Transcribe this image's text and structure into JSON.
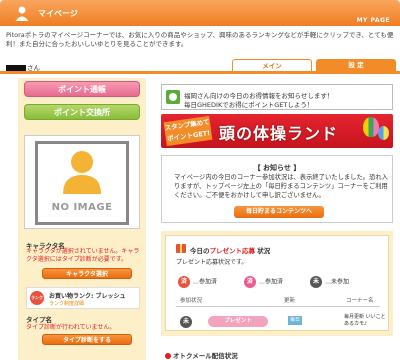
{
  "header": {
    "title": "マイページ",
    "right_label": "MY PAGE"
  },
  "intro": "Pitoraポトラのマイページコーナーでは、お気に入りの商品やショップ、興味のあるランキングなどが手軽にクリップでき、とても便利！また自分に合ったおいしいゆとりを見ることができます。",
  "user": {
    "suffix": "さん"
  },
  "tabs": {
    "main": "メイン",
    "settings": "設 定"
  },
  "left": {
    "btn_history": "ポイント通帳",
    "btn_exchange": "ポイント交換所",
    "no_image": "NO IMAGE",
    "chara_label": "キャラクタ名",
    "chara_note": "キャラクタが選択されていません。キャラクタ選択にはタイプ診断が必要です。",
    "chara_button": "キャラクタ選択",
    "rank_icon": "ランク",
    "rank_title": "お買い物ランク: ブレッシュ",
    "rank_sub": "ランク制度詳細",
    "type_label": "タイプ名",
    "type_note": "タイプ診断が行われていません。",
    "type_button": "タイプ診断をする"
  },
  "banner1": {
    "line1": "福岡さん向けの今日のお得情報をお知らせします！",
    "line2": "毎日GHEDIKでお得にポイントGETしよう！"
  },
  "banner2": {
    "tag": "スタンプ集めてポイントGET!",
    "title": "頭の体操ランド"
  },
  "notice": {
    "title": "【 お知らせ 】",
    "body": "マイページ内の今日のコーナー参加状況は、表示終了いたしました。恐れ入りますが、トップページ左上の「毎日貯まるコンテンツ」コーナーをご利用ください。ご不便をおかけして申し訳ございません。",
    "button": "毎日貯まるコンテンツへ"
  },
  "present": {
    "title_prefix": "今日の",
    "title_highlight": "プレゼント応募",
    "title_suffix": "状況",
    "subtitle": "プレゼント応募状況です。",
    "legend": [
      {
        "symbol": "済",
        "label": "…参加済"
      },
      {
        "symbol": "済",
        "label": "…参加済"
      },
      {
        "symbol": "未",
        "label": "…未参加"
      }
    ],
    "headers": {
      "status": "参加状況",
      "update": "更新",
      "corner": "コーナー名"
    },
    "row": {
      "symbol": "未",
      "button": "プレゼント",
      "update": "毎日",
      "corner": "毎月更新 いいことあるカモ♪"
    }
  },
  "mail": {
    "label": "オトクメール配信状況"
  }
}
